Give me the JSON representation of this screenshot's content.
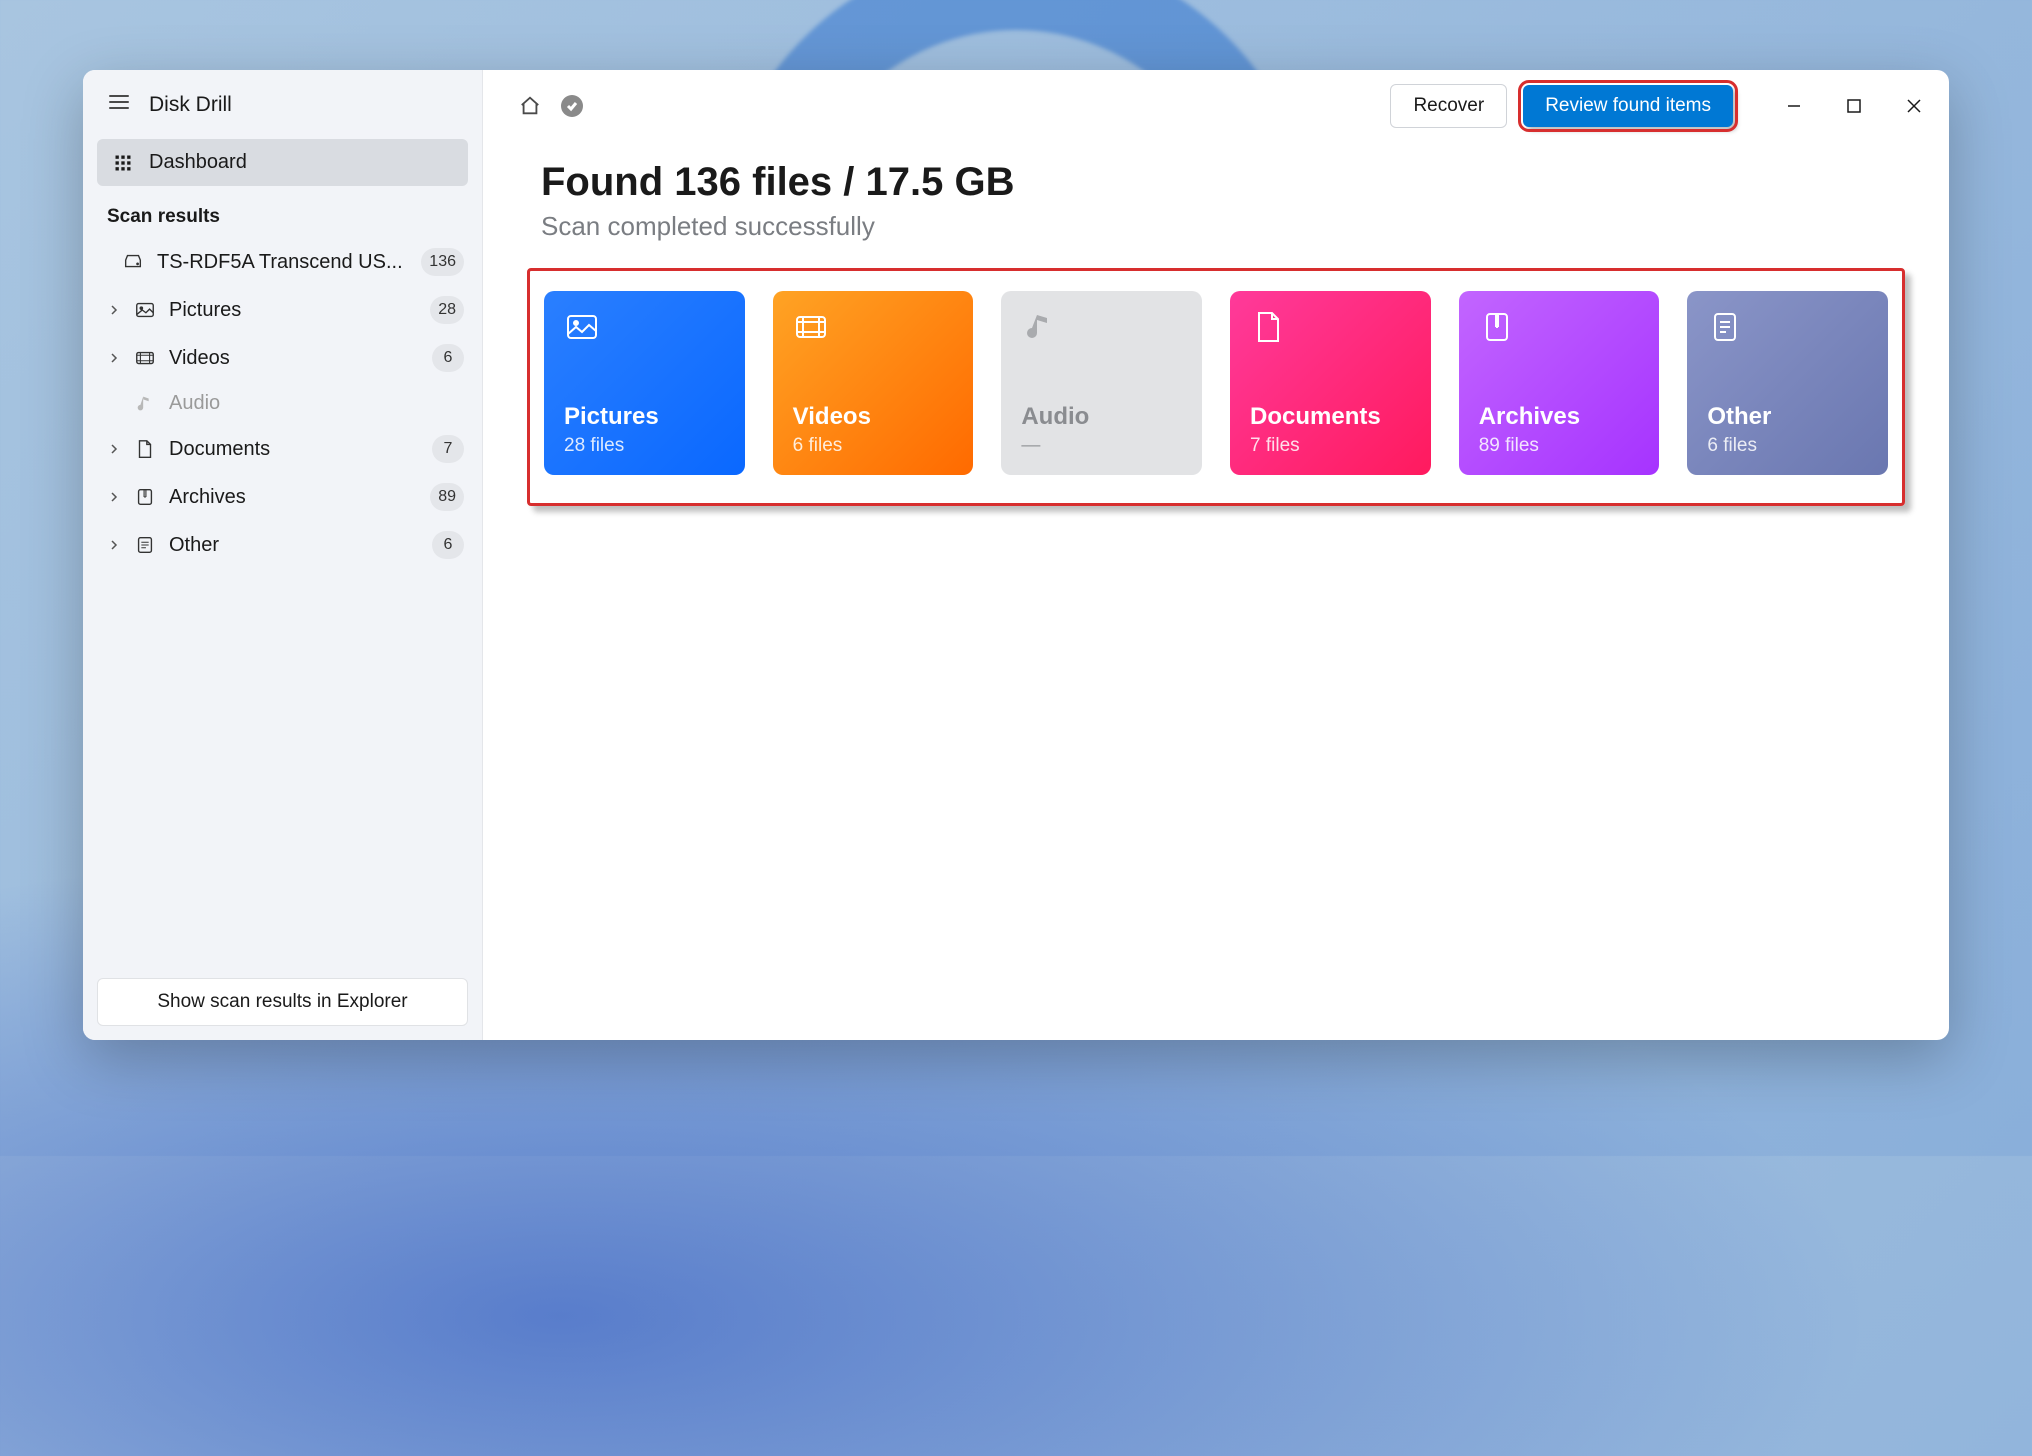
{
  "app": {
    "title": "Disk Drill"
  },
  "sidebar": {
    "dashboard": "Dashboard",
    "scan_results_header": "Scan results",
    "device": {
      "label": "TS-RDF5A Transcend US...",
      "count": "136"
    },
    "items": [
      {
        "label": "Pictures",
        "count": "28"
      },
      {
        "label": "Videos",
        "count": "6"
      },
      {
        "label": "Audio"
      },
      {
        "label": "Documents",
        "count": "7"
      },
      {
        "label": "Archives",
        "count": "89"
      },
      {
        "label": "Other",
        "count": "6"
      }
    ],
    "explorer_button": "Show scan results in Explorer"
  },
  "titlebar": {
    "recover": "Recover",
    "review": "Review found items"
  },
  "content": {
    "heading": "Found 136 files / 17.5 GB",
    "sub": "Scan completed successfully"
  },
  "cards": {
    "pictures": {
      "title": "Pictures",
      "sub": "28 files"
    },
    "videos": {
      "title": "Videos",
      "sub": "6 files"
    },
    "audio": {
      "title": "Audio",
      "sub": "—"
    },
    "documents": {
      "title": "Documents",
      "sub": "7 files"
    },
    "archives": {
      "title": "Archives",
      "sub": "89 files"
    },
    "other": {
      "title": "Other",
      "sub": "6 files"
    }
  }
}
